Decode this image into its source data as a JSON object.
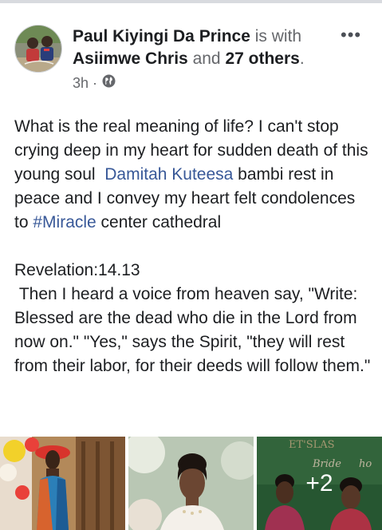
{
  "post_header": {
    "author": "Paul Kiyingi Da Prince",
    "with_text": "is with",
    "tagged": "Asiimwe Chris",
    "and_text": "and",
    "others": "27 others",
    "period": ".",
    "time": "3h",
    "privacy_icon": "globe-icon",
    "more_icon": "more-options-icon"
  },
  "post_body": {
    "p1_before": "What is the real meaning of life? I can't stop crying deep in my heart for sudden death of this young soul  ",
    "mention": "Damitah Kuteesa",
    "p1_middle": " bambi rest in peace and I convey my heart felt condolences to ",
    "hashtag": "#Miracle",
    "p1_after": " center cathedral",
    "p2": "Revelation:14.13\n Then I heard a voice from heaven say, \"Write: Blessed are the dead who die in the Lord from now on.\" \"Yes,\" says the Spirit, \"they will rest from their labor, for their deeds will follow them.\""
  },
  "gallery": {
    "more_count": "+2",
    "sign_text": "ET'SLAS",
    "sign_sub": "Bride",
    "sign_sub2": "ho"
  },
  "colors": {
    "link": "#385898",
    "muted": "#65676b",
    "text": "#1c1e21"
  }
}
